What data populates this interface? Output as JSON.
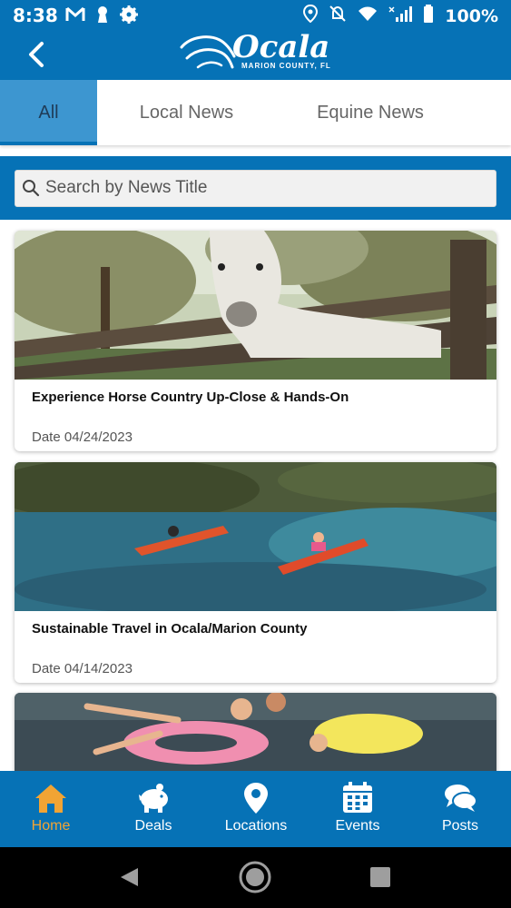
{
  "status_bar": {
    "time": "8:38",
    "battery": "100%"
  },
  "header": {
    "logo_word": "Ocala",
    "logo_sub": "MARION COUNTY, FL"
  },
  "tabs": [
    {
      "label": "All",
      "active": true
    },
    {
      "label": "Local News",
      "active": false
    },
    {
      "label": "Equine News",
      "active": false
    }
  ],
  "search": {
    "placeholder": "Search by News Title"
  },
  "articles": [
    {
      "title": "Experience Horse Country Up-Close & Hands-On",
      "date": "Date 04/24/2023"
    },
    {
      "title": "Sustainable Travel in Ocala/Marion County",
      "date": "Date 04/14/2023"
    },
    {
      "title": "",
      "date": ""
    }
  ],
  "bottom_nav": [
    {
      "label": "Home",
      "icon": "home-icon",
      "active": true
    },
    {
      "label": "Deals",
      "icon": "piggy-bank-icon",
      "active": false
    },
    {
      "label": "Locations",
      "icon": "map-pin-icon",
      "active": false
    },
    {
      "label": "Events",
      "icon": "calendar-icon",
      "active": false
    },
    {
      "label": "Posts",
      "icon": "chat-bubbles-icon",
      "active": false
    }
  ],
  "colors": {
    "brand_blue": "#0672b6",
    "active_tab": "#3d96d0",
    "nav_active": "#f1a434"
  }
}
